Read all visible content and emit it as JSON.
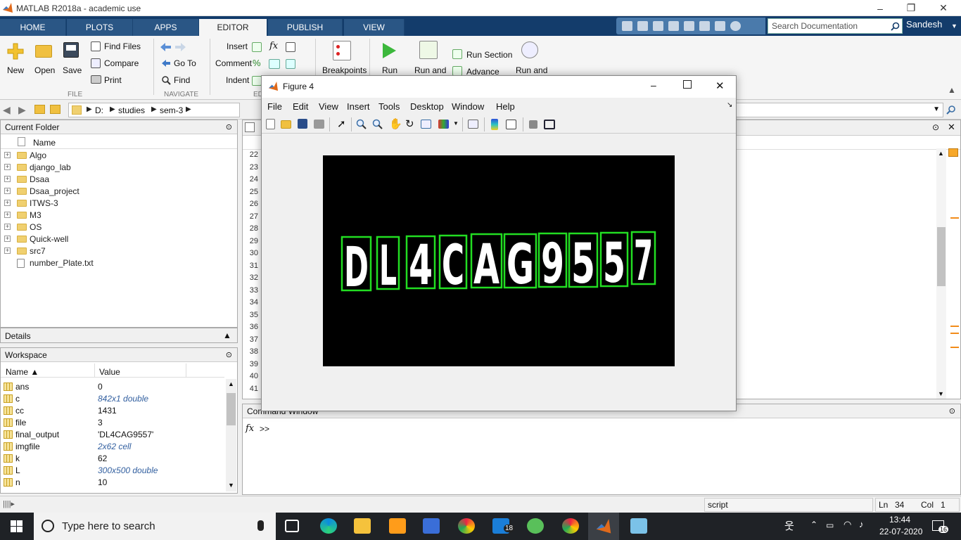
{
  "window": {
    "title": "MATLAB R2018a - academic use",
    "minimize": "–",
    "restore": "❐",
    "close": "✕"
  },
  "tabs": [
    {
      "label": "HOME"
    },
    {
      "label": "PLOTS"
    },
    {
      "label": "APPS"
    },
    {
      "label": "EDITOR"
    },
    {
      "label": "PUBLISH"
    },
    {
      "label": "VIEW"
    }
  ],
  "search": {
    "placeholder": "Search Documentation"
  },
  "user": "Sandesh",
  "toolstrip": {
    "file": {
      "new": "New",
      "open": "Open",
      "save": "Save",
      "find_files": "Find Files",
      "compare": "Compare",
      "print": "Print",
      "section": "FILE"
    },
    "navigate": {
      "go_to": "Go To",
      "find": "Find",
      "section": "NAVIGATE"
    },
    "edit": {
      "insert": "Insert",
      "comment": "Comment",
      "indent": "Indent",
      "fx": "fx",
      "section": "ED"
    },
    "breakpoints": "Breakpoints",
    "run": {
      "run": "Run",
      "run_and": "Run and",
      "run_section": "Run Section",
      "advance": "Advance",
      "run_and2": "Run and"
    }
  },
  "address": {
    "path": [
      "D:",
      "studies",
      "sem-3"
    ]
  },
  "current_folder": {
    "title": "Current Folder",
    "column": "Name",
    "items": [
      {
        "name": "Algo",
        "type": "folder"
      },
      {
        "name": "django_lab",
        "type": "folder"
      },
      {
        "name": "Dsaa",
        "type": "folder"
      },
      {
        "name": "Dsaa_project",
        "type": "folder"
      },
      {
        "name": "ITWS-3",
        "type": "folder"
      },
      {
        "name": "M3",
        "type": "folder"
      },
      {
        "name": "OS",
        "type": "folder"
      },
      {
        "name": "Quick-well",
        "type": "folder"
      },
      {
        "name": "src7",
        "type": "folder"
      },
      {
        "name": "number_Plate.txt",
        "type": "file"
      }
    ]
  },
  "details": {
    "title": "Details"
  },
  "workspace": {
    "title": "Workspace",
    "col_name": "Name ▲",
    "col_value": "Value",
    "rows": [
      {
        "name": "ans",
        "value": "0",
        "italic": false
      },
      {
        "name": "c",
        "value": "842x1 double",
        "italic": true
      },
      {
        "name": "cc",
        "value": "1431",
        "italic": false
      },
      {
        "name": "file",
        "value": "3",
        "italic": false
      },
      {
        "name": "final_output",
        "value": "'DL4CAG9557'",
        "italic": false
      },
      {
        "name": "imgfile",
        "value": "2x62 cell",
        "italic": true
      },
      {
        "name": "k",
        "value": "62",
        "italic": false
      },
      {
        "name": "L",
        "value": "300x500 double",
        "italic": true
      },
      {
        "name": "n",
        "value": "10",
        "italic": false
      }
    ]
  },
  "editor": {
    "line_numbers": [
      "22",
      "23",
      "24",
      "25",
      "26",
      "27",
      "28",
      "29",
      "30",
      "31",
      "32",
      "33",
      "34",
      "35",
      "36",
      "37",
      "38",
      "39",
      "40",
      "41"
    ]
  },
  "command_window": {
    "title": "Command Window",
    "prompt": ">>",
    "fx": "fx"
  },
  "status": {
    "type": "script",
    "ln_label": "Ln",
    "ln": "34",
    "col_label": "Col",
    "col": "1"
  },
  "figure": {
    "title": "Figure 4",
    "menu": [
      "File",
      "Edit",
      "View",
      "Insert",
      "Tools",
      "Desktop",
      "Window",
      "Help"
    ],
    "plate_chars": [
      "D",
      "L",
      "4",
      "C",
      "A",
      "G",
      "9",
      "5",
      "5",
      "7"
    ],
    "box_color": "#22dd22"
  },
  "taskbar": {
    "search_placeholder": "Type here to search",
    "time": "13:44",
    "date": "22-07-2020",
    "mail_badge": "18",
    "notif_badge": "16"
  }
}
